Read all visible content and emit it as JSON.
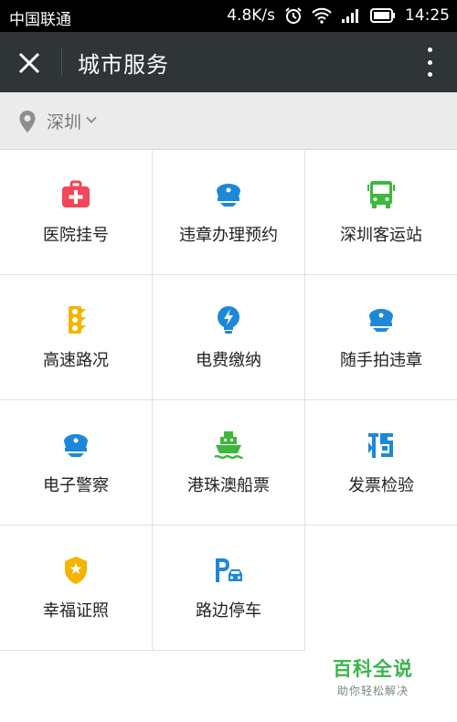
{
  "status_bar": {
    "carrier": "中国联通",
    "speed": "4.8K/s",
    "time": "14:25"
  },
  "header": {
    "title": "城市服务",
    "close_icon": "close-icon",
    "more_icon": "more-vertical-icon"
  },
  "location": {
    "city": "深圳",
    "pin_icon": "location-pin-icon"
  },
  "services": [
    {
      "label": "医院挂号",
      "icon": "hospital-kit-icon",
      "color": "#f0485a"
    },
    {
      "label": "违章办理预约",
      "icon": "police-cap-icon",
      "color": "#1e88d8"
    },
    {
      "label": "深圳客运站",
      "icon": "bus-icon",
      "color": "#3cb93c"
    },
    {
      "label": "高速路况",
      "icon": "traffic-light-icon",
      "color": "#f5b400"
    },
    {
      "label": "电费缴纳",
      "icon": "lightning-bulb-icon",
      "color": "#1e88d8"
    },
    {
      "label": "随手拍违章",
      "icon": "police-cap-icon",
      "color": "#1e88d8"
    },
    {
      "label": "电子警察",
      "icon": "police-cap-icon",
      "color": "#1e88d8"
    },
    {
      "label": "港珠澳船票",
      "icon": "ship-icon",
      "color": "#3cb93c"
    },
    {
      "label": "发票检验",
      "icon": "tax-invoice-icon",
      "color": "#1e88d8"
    },
    {
      "label": "幸福证照",
      "icon": "badge-shield-icon",
      "color": "#f5b400"
    },
    {
      "label": "路边停车",
      "icon": "parking-car-icon",
      "color": "#1e88d8"
    }
  ],
  "watermark": {
    "title": "百科全说",
    "subtitle": "助你轻松解决"
  }
}
